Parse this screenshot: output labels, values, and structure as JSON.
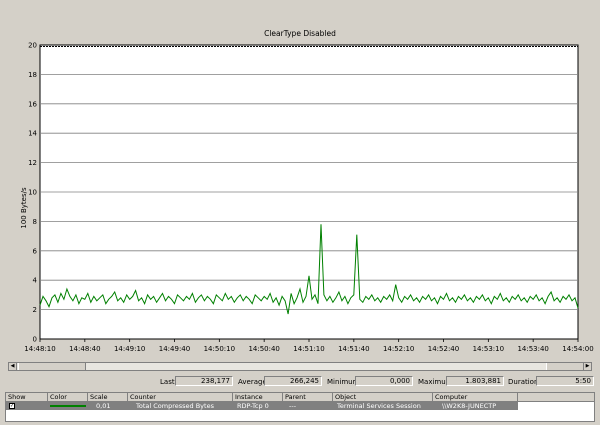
{
  "chart_data": {
    "type": "line",
    "title": "ClearType Disabled",
    "ylabel": "100 Bytes/s",
    "ylim": [
      0,
      20
    ],
    "yticks": [
      "0",
      "2",
      "4",
      "6",
      "8",
      "10",
      "12",
      "14",
      "16",
      "18",
      "20"
    ],
    "xticks": [
      "14:48:10",
      "14:48:40",
      "14:49:10",
      "14:49:40",
      "14:50:10",
      "14:50:40",
      "14:51:10",
      "14:51:40",
      "14:52:10",
      "14:52:40",
      "14:53:10",
      "14:53:40",
      "14:54:00"
    ],
    "grid": true,
    "series": [
      {
        "color": "#008000",
        "values": [
          2.3,
          2.9,
          2.6,
          2.2,
          2.8,
          3.0,
          2.5,
          3.1,
          2.7,
          3.4,
          2.9,
          2.6,
          3.0,
          2.4,
          2.8,
          2.7,
          3.1,
          2.5,
          2.9,
          2.6,
          2.8,
          3.0,
          2.4,
          2.7,
          2.9,
          3.2,
          2.6,
          2.8,
          2.5,
          3.0,
          2.7,
          2.9,
          3.3,
          2.6,
          2.8,
          2.4,
          3.0,
          2.7,
          2.9,
          2.5,
          2.8,
          3.1,
          2.6,
          2.9,
          2.7,
          2.4,
          3.0,
          2.8,
          2.6,
          2.9,
          2.7,
          3.1,
          2.5,
          2.8,
          3.0,
          2.6,
          2.9,
          2.7,
          2.4,
          3.0,
          2.8,
          2.6,
          3.1,
          2.7,
          2.9,
          2.5,
          2.8,
          3.0,
          2.6,
          2.9,
          2.7,
          2.4,
          3.0,
          2.8,
          2.6,
          2.9,
          2.7,
          3.1,
          2.5,
          2.8,
          2.3,
          2.9,
          2.6,
          1.7,
          3.1,
          2.4,
          2.8,
          3.4,
          2.5,
          2.9,
          4.3,
          2.7,
          3.0,
          2.4,
          7.8,
          3.0,
          2.6,
          2.9,
          2.5,
          2.8,
          3.2,
          2.6,
          2.9,
          2.4,
          2.8,
          3.0,
          7.1,
          2.7,
          2.5,
          2.9,
          2.7,
          3.0,
          2.6,
          2.8,
          2.5,
          2.9,
          2.7,
          3.0,
          2.6,
          3.7,
          2.8,
          2.5,
          2.9,
          2.7,
          3.0,
          2.6,
          2.8,
          2.5,
          2.9,
          2.7,
          3.0,
          2.6,
          2.8,
          2.4,
          2.9,
          2.7,
          3.1,
          2.6,
          2.8,
          2.5,
          2.9,
          2.7,
          3.0,
          2.6,
          2.8,
          2.5,
          2.9,
          2.7,
          3.0,
          2.6,
          2.8,
          2.4,
          2.9,
          2.7,
          3.1,
          2.6,
          2.8,
          2.5,
          2.9,
          2.7,
          3.0,
          2.6,
          2.8,
          2.5,
          2.9,
          2.7,
          3.0,
          2.6,
          2.8,
          2.4,
          2.9,
          3.2,
          2.6,
          2.8,
          2.5,
          2.9,
          2.7,
          3.0,
          2.6,
          2.8,
          2.1
        ]
      }
    ]
  },
  "stats": {
    "last_label": "Last",
    "last_value": "238,177",
    "average_label": "Average",
    "average_value": "266,245",
    "minimum_label": "Minimum",
    "minimum_value": "0,000",
    "maximum_label": "Maximum",
    "maximum_value": "1.803,881",
    "duration_label": "Duration",
    "duration_value": "5:50"
  },
  "legend": {
    "headers": {
      "show": "Show",
      "color": "Color",
      "scale": "Scale",
      "counter": "Counter",
      "instance": "Instance",
      "parent": "Parent",
      "object": "Object",
      "computer": "Computer"
    },
    "row": {
      "checked": "✓",
      "color": "#008000",
      "scale": "0,01",
      "counter": "Total Compressed Bytes",
      "instance": "RDP-Tcp 0",
      "parent": "---",
      "object": "Terminal Services Session",
      "computer": "\\\\W2K8-JUNECTP"
    }
  },
  "scrollbar": {
    "thumb_position": 0.97
  }
}
